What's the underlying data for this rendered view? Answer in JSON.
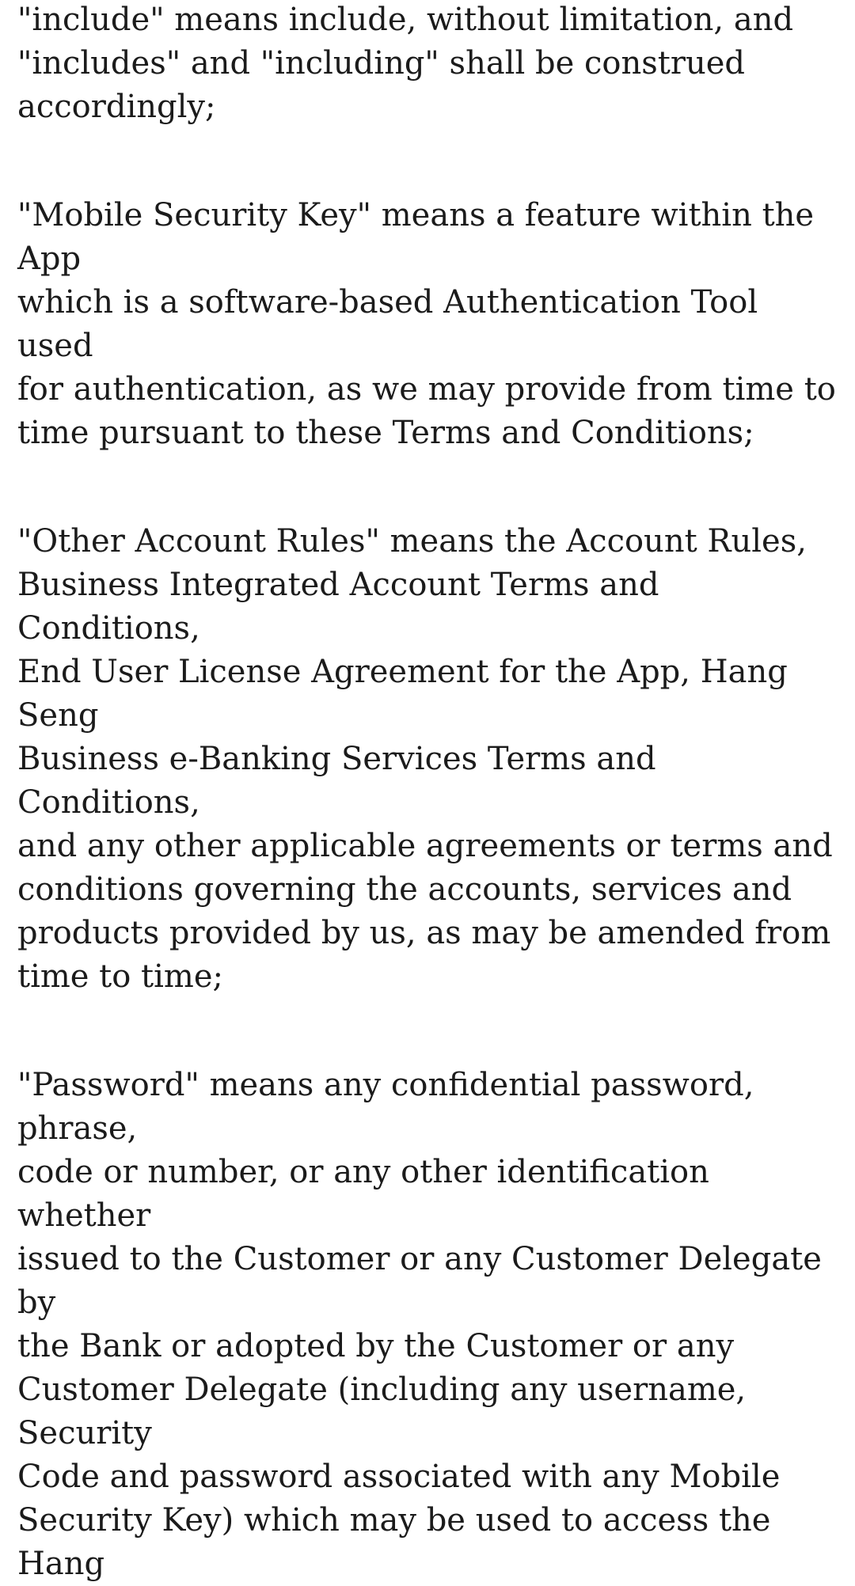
{
  "paragraphs": [
    {
      "text": "\"include\" means include, without limitation, and\n\"includes\" and \"including\" shall be construed\naccordingly;"
    },
    {
      "text": "\"Mobile Security Key\" means a feature within the App\nwhich is a software-based Authentication Tool used\nfor authentication, as we may provide from time to\ntime pursuant to these Terms and Conditions;"
    },
    {
      "text": "\"Other Account Rules\" means the Account Rules,\nBusiness Integrated Account Terms and Conditions,\nEnd User License Agreement for the App, Hang Seng\nBusiness e-Banking Services Terms and Conditions,\nand any other applicable agreements or terms and\nconditions governing the accounts, services and\nproducts provided by us, as may be amended from\ntime to time;"
    },
    {
      "text": "\"Password\" means any confidential password, phrase,\ncode or number, or any other identification whether\nissued to the Customer or any Customer Delegate by\nthe Bank or adopted by the Customer or any\nCustomer Delegate (including any username, Security\nCode and password associated with any Mobile\nSecurity Key) which may be used to access the Hang"
    }
  ]
}
